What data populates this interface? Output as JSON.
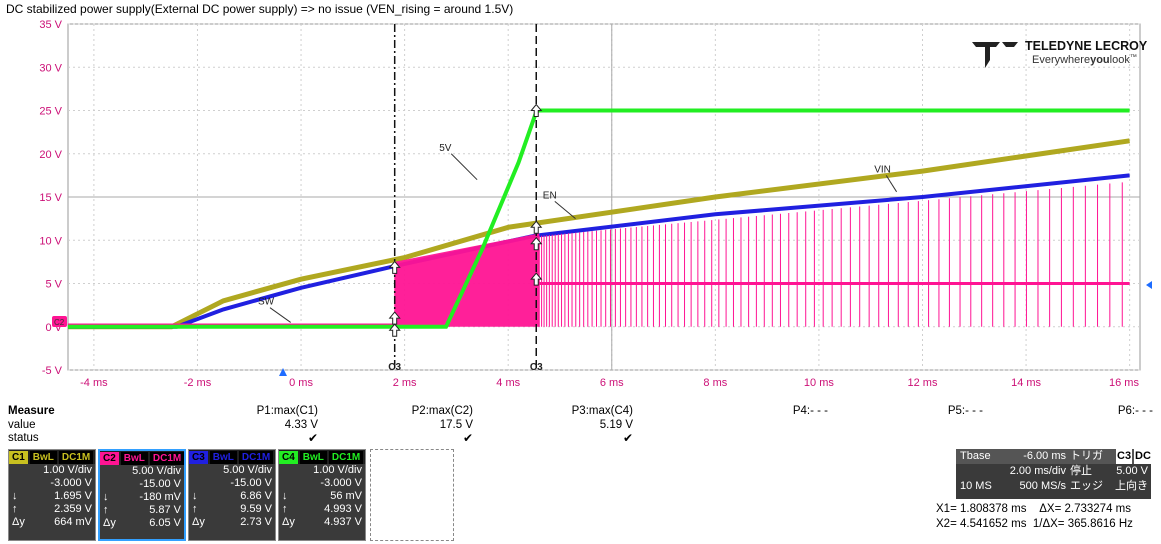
{
  "caption": "DC stabilized power supply(External DC power supply) => no issue (VEN_rising = around 1.5V)",
  "logo": {
    "brand": "TELEDYNE LECROY",
    "tagline_a": "Everywhere",
    "tagline_b": "you",
    "tagline_c": "look",
    "tm": "™"
  },
  "y_ticks": [
    "35 V",
    "30 V",
    "25 V",
    "20 V",
    "15 V",
    "10 V",
    "5 V",
    "0 V",
    "-5 V"
  ],
  "x_ticks": [
    "-4 ms",
    "-2 ms",
    "0 ms",
    "2 ms",
    "4 ms",
    "6 ms",
    "8 ms",
    "10 ms",
    "12 ms",
    "14 ms",
    "16 ms"
  ],
  "trace_labels": {
    "v5": "5V",
    "en": "EN",
    "vin": "VIN",
    "sw": "SW"
  },
  "cursor_labels": {
    "c1": "C3",
    "c2": "C3"
  },
  "chart_data": {
    "type": "line",
    "xlabel": "",
    "ylabel": "",
    "xlim": [
      -4.5,
      16.2
    ],
    "ylim": [
      -5,
      35
    ],
    "x_unit": "ms",
    "y_unit": "V",
    "grid": true,
    "cursors": [
      1.808378,
      4.541652
    ],
    "series": [
      {
        "name": "5V",
        "color": "#22ee22",
        "x": [
          -4.5,
          -2.5,
          2.8,
          3.5,
          4.2,
          4.55,
          16
        ],
        "y": [
          0,
          0,
          0,
          9,
          19,
          25,
          25
        ]
      },
      {
        "name": "EN",
        "color": "#b0a820",
        "x": [
          -4.5,
          -2.5,
          -1.5,
          0,
          2,
          4,
          8,
          12,
          16
        ],
        "y": [
          0,
          0,
          3,
          5.5,
          8,
          11.5,
          15,
          18,
          21.5
        ]
      },
      {
        "name": "VIN",
        "color": "#2020e0",
        "x": [
          -4.5,
          -2.4,
          -1.5,
          0,
          1.8,
          4.5,
          8,
          12,
          16
        ],
        "y": [
          0,
          0,
          2,
          4.5,
          7,
          10.5,
          13,
          15,
          17.5
        ]
      },
      {
        "name": "SW",
        "color": "#ff1493",
        "x": [
          -4.5,
          1.8,
          1.8,
          4.6,
          4.6,
          16
        ],
        "y": [
          0.2,
          0.2,
          7,
          10.5,
          5,
          5
        ]
      }
    ]
  },
  "measure": {
    "title": "Measure",
    "row_value": "value",
    "row_status": "status",
    "params": [
      {
        "label": "P1:max(C1)",
        "value": "4.33 V",
        "status": "✔"
      },
      {
        "label": "P2:max(C2)",
        "value": "17.5 V",
        "status": "✔"
      },
      {
        "label": "P3:max(C4)",
        "value": "5.19 V",
        "status": "✔"
      },
      {
        "label": "P4:- - -",
        "value": "",
        "status": ""
      },
      {
        "label": "P5:- - -",
        "value": "",
        "status": ""
      },
      {
        "label": "P6:- - -",
        "value": "",
        "status": ""
      }
    ]
  },
  "channels": [
    {
      "id": "C1",
      "color": "#c8c020",
      "bw": "BwL",
      "cpl": "DC1M",
      "vdiv": "1.00 V/div",
      "offset": "-3.000 V",
      "l3": "1.695 V",
      "l4": "2.359 V",
      "dy": "664 mV"
    },
    {
      "id": "C2",
      "color": "#ff1493",
      "bw": "BwL",
      "cpl": "DC1M",
      "vdiv": "5.00 V/div",
      "offset": "-15.00 V",
      "l3": "-180 mV",
      "l4": "5.87 V",
      "dy": "6.05 V"
    },
    {
      "id": "C3",
      "color": "#2020e0",
      "bw": "BwL",
      "cpl": "DC1M",
      "vdiv": "5.00 V/div",
      "offset": "-15.00 V",
      "l3": "6.86 V",
      "l4": "9.59 V",
      "dy": "2.73 V"
    },
    {
      "id": "C4",
      "color": "#22ee22",
      "bw": "BwL",
      "cpl": "DC1M",
      "vdiv": "1.00 V/div",
      "offset": "-3.000 V",
      "l3": "56 mV",
      "l4": "4.993 V",
      "dy": "4.937 V"
    }
  ],
  "timebase": {
    "label": "Tbase",
    "delay": "-6.00 ms",
    "trig_label": "トリガ",
    "trig_src": "C3",
    "trig_cpl": "DC",
    "tdiv": "2.00 ms/div",
    "mode": "停止",
    "level": "5.00 V",
    "points": "10 MS",
    "rate": "500 MS/s",
    "type": "エッジ",
    "slope": "上向き"
  },
  "cursor_readout": {
    "x1": "X1=  1.808378 ms",
    "dx": "ΔX=  2.733274 ms",
    "x2": "X2=  4.541652 ms",
    "inv": "1/ΔX=  365.8616 Hz"
  }
}
